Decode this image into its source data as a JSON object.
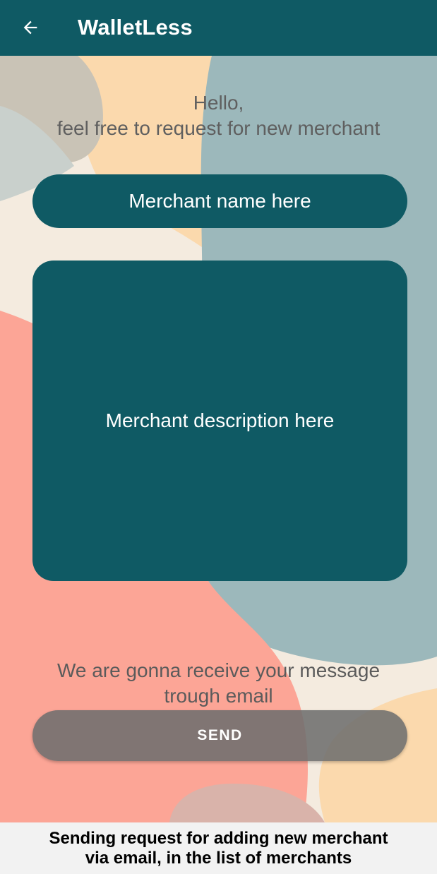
{
  "app_bar": {
    "title": "WalletLess",
    "back_icon": "arrow-left-icon",
    "color": "#0f5a64"
  },
  "greeting": {
    "line1": "Hello,",
    "line2": "feel free to request for new merchant"
  },
  "form": {
    "name_placeholder": "Merchant name here",
    "description_placeholder": "Merchant description here",
    "field_color": "#0f5a64"
  },
  "info": {
    "line1": "We are gonna receive your message",
    "line2": "trough email"
  },
  "send_button": {
    "label": "SEND"
  },
  "caption": {
    "line1": "Sending request for adding new merchant",
    "line2": "via email, in the list of merchants"
  }
}
